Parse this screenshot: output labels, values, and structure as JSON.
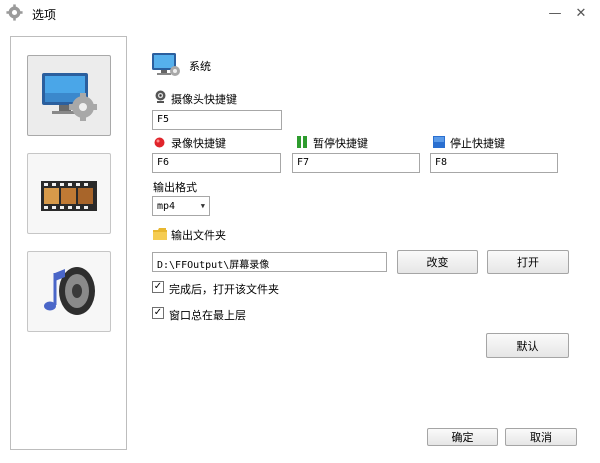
{
  "window": {
    "title": "选项",
    "minimize_glyph": "—",
    "close_glyph": "✕"
  },
  "sidebar": {
    "items": [
      {
        "name": "system",
        "icon": "system-settings-icon",
        "active": true
      },
      {
        "name": "video",
        "icon": "film-reel-icon",
        "active": false
      },
      {
        "name": "audio",
        "icon": "speaker-music-icon",
        "active": false
      }
    ]
  },
  "section": {
    "title": "系统",
    "icon": "monitor-icon"
  },
  "camera_hotkey": {
    "label": "摄像头快捷键",
    "value": "F5",
    "icon": "webcam-icon"
  },
  "record_hotkey": {
    "label": "录像快捷键",
    "value": "F6",
    "icon": "record-dot-icon",
    "color": "#e0242b"
  },
  "pause_hotkey": {
    "label": "暂停快捷键",
    "value": "F7",
    "icon": "pause-icon",
    "color": "#2e9c2e"
  },
  "stop_hotkey": {
    "label": "停止快捷键",
    "value": "F8",
    "icon": "stop-square-icon",
    "color": "#2a6fd0"
  },
  "output_format": {
    "label": "输出格式",
    "value": "mp4",
    "arrow": "▼"
  },
  "output_folder": {
    "label": "输出文件夹",
    "path": "D:\\FFOutput\\屏幕录像",
    "icon": "folder-icon",
    "change_label": "改变",
    "open_label": "打开"
  },
  "options": {
    "open_after": {
      "label": "完成后，打开该文件夹",
      "checked": true,
      "mark": "✓"
    },
    "always_on_top": {
      "label": "窗口总在最上层",
      "checked": true,
      "mark": "✓"
    }
  },
  "buttons": {
    "default": "默认",
    "ok": "确定",
    "cancel": "取消"
  }
}
